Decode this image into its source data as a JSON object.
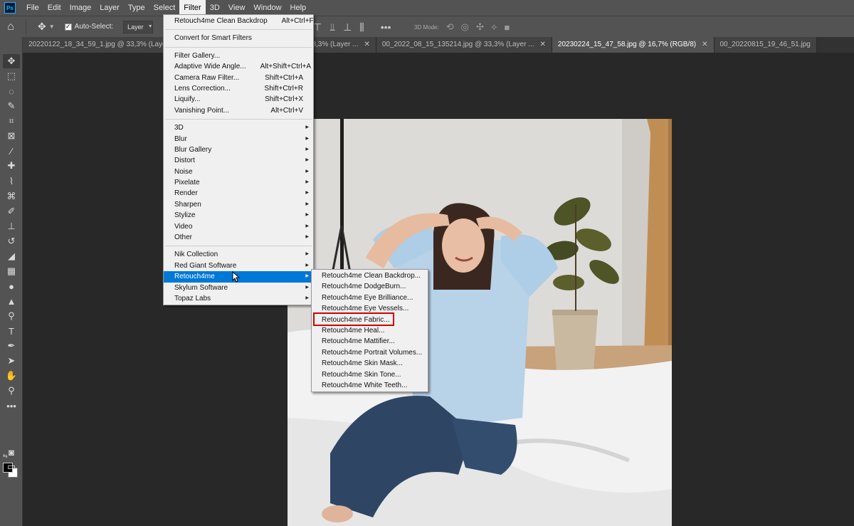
{
  "menubar": {
    "logo": "Ps",
    "items": [
      "File",
      "Edit",
      "Image",
      "Layer",
      "Type",
      "Select",
      "Filter",
      "3D",
      "View",
      "Window",
      "Help"
    ],
    "active_index": 6
  },
  "options": {
    "auto_select_label": "Auto-Select:",
    "auto_select_checked": true,
    "target_value": "Layer",
    "mode_3d_label": "3D Mode:"
  },
  "tabs": [
    {
      "label": "20220122_18_34_59_1.jpg @ 33,3% (Layer 1,...",
      "active": false
    },
    {
      "label": "00_20220407_16_00_08.jpg @ 33,3% (Layer ...",
      "active": false
    },
    {
      "label": "00_2022_08_15_135214.jpg @ 33,3% (Layer ...",
      "active": false
    },
    {
      "label": "20230224_15_47_58.jpg @ 16,7% (RGB/8)",
      "active": true
    },
    {
      "label": "00_20220815_19_46_51.jpg",
      "active": false
    }
  ],
  "filter_menu": {
    "top": [
      {
        "label": "Retouch4me Clean Backdrop",
        "shortcut": "Alt+Ctrl+F"
      }
    ],
    "smart": [
      {
        "label": "Convert for Smart Filters",
        "shortcut": ""
      }
    ],
    "filters": [
      {
        "label": "Filter Gallery...",
        "shortcut": ""
      },
      {
        "label": "Adaptive Wide Angle...",
        "shortcut": "Alt+Shift+Ctrl+A"
      },
      {
        "label": "Camera Raw Filter...",
        "shortcut": "Shift+Ctrl+A"
      },
      {
        "label": "Lens Correction...",
        "shortcut": "Shift+Ctrl+R"
      },
      {
        "label": "Liquify...",
        "shortcut": "Shift+Ctrl+X"
      },
      {
        "label": "Vanishing Point...",
        "shortcut": "Alt+Ctrl+V"
      }
    ],
    "groups": [
      "3D",
      "Blur",
      "Blur Gallery",
      "Distort",
      "Noise",
      "Pixelate",
      "Render",
      "Sharpen",
      "Stylize",
      "Video",
      "Other"
    ],
    "plugins": [
      "Nik Collection",
      "Red Giant Software",
      "Retouch4me",
      "Skylum Software",
      "Topaz Labs"
    ],
    "highlighted": "Retouch4me"
  },
  "submenu": {
    "items": [
      "Retouch4me Clean Backdrop...",
      "Retouch4me DodgeBurn...",
      "Retouch4me Eye Brilliance...",
      "Retouch4me Eye Vessels...",
      "Retouch4me Fabric...",
      "Retouch4me Heal...",
      "Retouch4me Mattifier...",
      "Retouch4me Portrait Volumes...",
      "Retouch4me Skin Mask...",
      "Retouch4me Skin Tone...",
      "Retouch4me White Teeth..."
    ],
    "boxed": "Retouch4me Fabric..."
  },
  "colors": {
    "accent": "#0078d7",
    "box": "#d20000",
    "menu_bg": "#f0f0f0",
    "chrome": "#535353",
    "canvas": "#282828"
  },
  "icons": [
    "home-icon",
    "move-icon",
    "marquee-icon",
    "lasso-icon",
    "quick-select-icon",
    "crop-icon",
    "eyedropper-icon",
    "healing-icon",
    "brush-icon",
    "stamp-icon",
    "eraser-icon",
    "gradient-icon",
    "blur-icon",
    "dodge-icon",
    "pen-icon",
    "type-icon",
    "path-select-icon",
    "hand-icon",
    "zoom-icon",
    "ellipsis-icon"
  ]
}
